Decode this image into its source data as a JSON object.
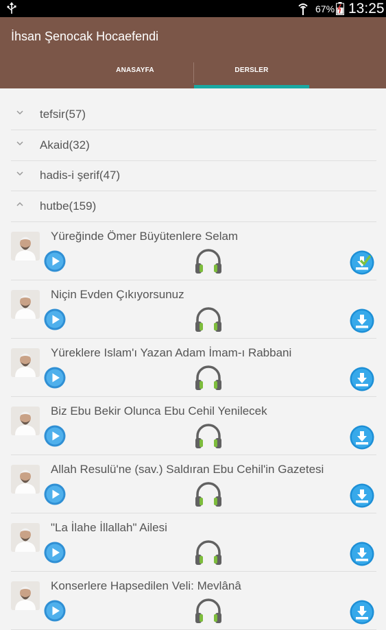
{
  "status_bar": {
    "battery_percent": "67%",
    "time": "13:25",
    "icons": [
      "usb-icon",
      "signal-icon",
      "battery-icon"
    ]
  },
  "app_bar": {
    "title": "İhsan Şenocak Hocaefendi",
    "color": "#7b5648"
  },
  "tabs": [
    {
      "label": "ANASAYFA",
      "selected": false
    },
    {
      "label": "DERSLER",
      "selected": true
    }
  ],
  "accent_color": "#1aa9a2",
  "categories": [
    {
      "label": "tefsir(57)",
      "expanded": false,
      "icon": "chevron-down-icon"
    },
    {
      "label": "Akaid(32)",
      "expanded": false,
      "icon": "chevron-down-icon"
    },
    {
      "label": "hadis-i şerif(47)",
      "expanded": false,
      "icon": "chevron-down-icon"
    },
    {
      "label": "hutbe(159)",
      "expanded": true,
      "icon": "chevron-up-icon"
    }
  ],
  "tracks": [
    {
      "title": "Yüreğinde Ömer Büyütenlere Selam",
      "downloaded": true
    },
    {
      "title": "Niçin Evden Çıkıyorsunuz",
      "downloaded": false
    },
    {
      "title": "Yüreklere Islam'ı Yazan Adam İmam-ı Rabbani",
      "downloaded": false
    },
    {
      "title": "Biz Ebu Bekir Olunca Ebu Cehil Yenilecek",
      "downloaded": false
    },
    {
      "title": "Allah Resulü'ne (sav.) Saldıran Ebu Cehil'in Gazetesi",
      "downloaded": false
    },
    {
      "title": "\"La İlahe İllallah\" Ailesi",
      "downloaded": false
    },
    {
      "title": "Konserlere Hapsedilen Veli: Mevlânâ",
      "downloaded": false
    }
  ]
}
